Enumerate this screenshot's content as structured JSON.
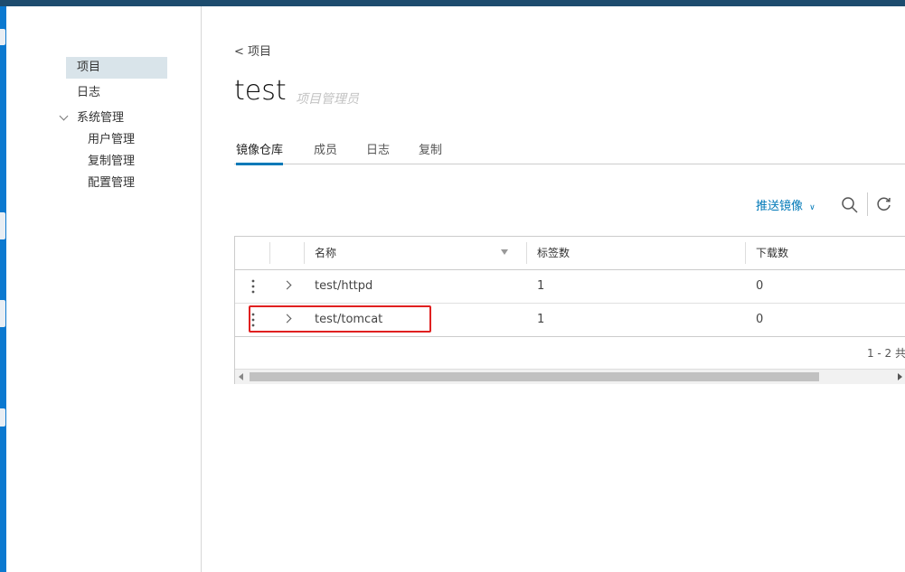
{
  "sidebar": {
    "items": [
      {
        "label": "项目"
      },
      {
        "label": "日志"
      },
      {
        "label": "系统管理"
      },
      {
        "label": "用户管理"
      },
      {
        "label": "复制管理"
      },
      {
        "label": "配置管理"
      }
    ]
  },
  "breadcrumb": "< 项目",
  "project": {
    "title": "test",
    "role": "项目管理员"
  },
  "tabs": [
    {
      "label": "镜像仓库"
    },
    {
      "label": "成员"
    },
    {
      "label": "日志"
    },
    {
      "label": "复制"
    }
  ],
  "toolbar": {
    "push_label": "推送镜像"
  },
  "table": {
    "columns": [
      "名称",
      "标签数",
      "下载数"
    ],
    "rows": [
      {
        "name": "test/httpd",
        "tags": "1",
        "pulls": "0"
      },
      {
        "name": "test/tomcat",
        "tags": "1",
        "pulls": "0"
      }
    ],
    "footer": "1 - 2 共"
  },
  "colors": {
    "accent": "#0079b8",
    "highlight": "#e02020",
    "topbar": "#1d4c6e"
  }
}
